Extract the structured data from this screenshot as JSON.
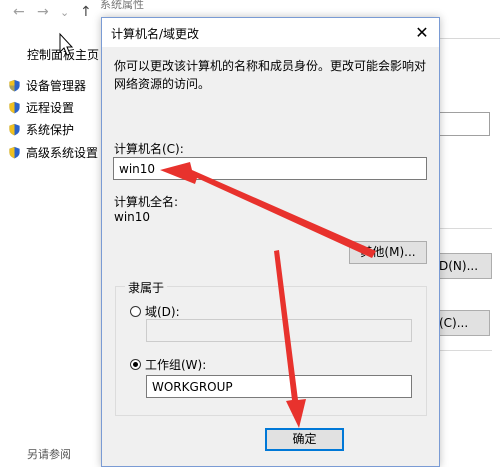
{
  "background": {
    "window_title": "系统属性",
    "nav": {
      "back": "←",
      "forward": "→",
      "dropdown": "⌄",
      "up": "↑"
    },
    "control_panel_home": "控制面板主页",
    "sidebar_items": [
      {
        "label": "设备管理器"
      },
      {
        "label": "远程设置"
      },
      {
        "label": "系统保护"
      },
      {
        "label": "高级系统设置"
      }
    ],
    "see_also": "另请参阅",
    "right_button_id": "D(N)...",
    "right_button_change": "(C)..."
  },
  "dialog": {
    "title": "计算机名/域更改",
    "close": "✕",
    "description": "你可以更改该计算机的名称和成员身份。更改可能会影响对网络资源的访问。",
    "computer_name_label": "计算机名(C):",
    "computer_name_value": "win10",
    "full_name_label": "计算机全名:",
    "full_name_value": "win10",
    "more_button": "其他(M)...",
    "member_of_label": "隶属于",
    "domain_radio_label": "域(D):",
    "domain_value": "",
    "workgroup_radio_label": "工作组(W):",
    "workgroup_value": "WORKGROUP",
    "ok_button": "确定",
    "selected_membership": "workgroup"
  },
  "colors": {
    "annotation_arrow": "#e8322d",
    "default_button_border": "#0078d7"
  },
  "icons": {
    "sidebar": "uac-shield-icon",
    "close": "close-icon"
  }
}
